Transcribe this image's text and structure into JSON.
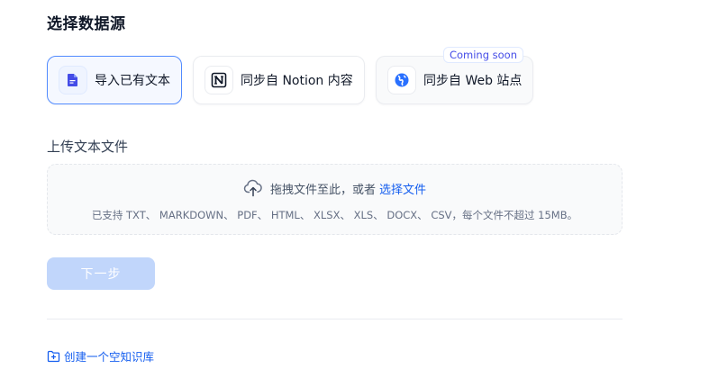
{
  "section_title": "选择数据源",
  "sources": [
    {
      "label": "导入已有文本",
      "icon": "document-icon",
      "state": "selected"
    },
    {
      "label": "同步自 Notion 内容",
      "icon": "notion-icon",
      "state": "normal"
    },
    {
      "label": "同步自 Web 站点",
      "icon": "web-icon",
      "state": "disabled",
      "badge": "Coming soon"
    }
  ],
  "upload": {
    "title": "上传文本文件",
    "drag_text": "拖拽文件至此，或者",
    "select_link": "选择文件",
    "support_text": "已支持 TXT、 MARKDOWN、 PDF、 HTML、 XLSX、 XLS、 DOCX、 CSV，每个文件不超过 15MB。"
  },
  "next_button": "下一步",
  "create_empty": "创建一个空知识库",
  "colors": {
    "accent": "#155eef",
    "selected_border": "#528bff",
    "disabled_button": "#c1d6fb",
    "badge_text": "#444ce7"
  }
}
